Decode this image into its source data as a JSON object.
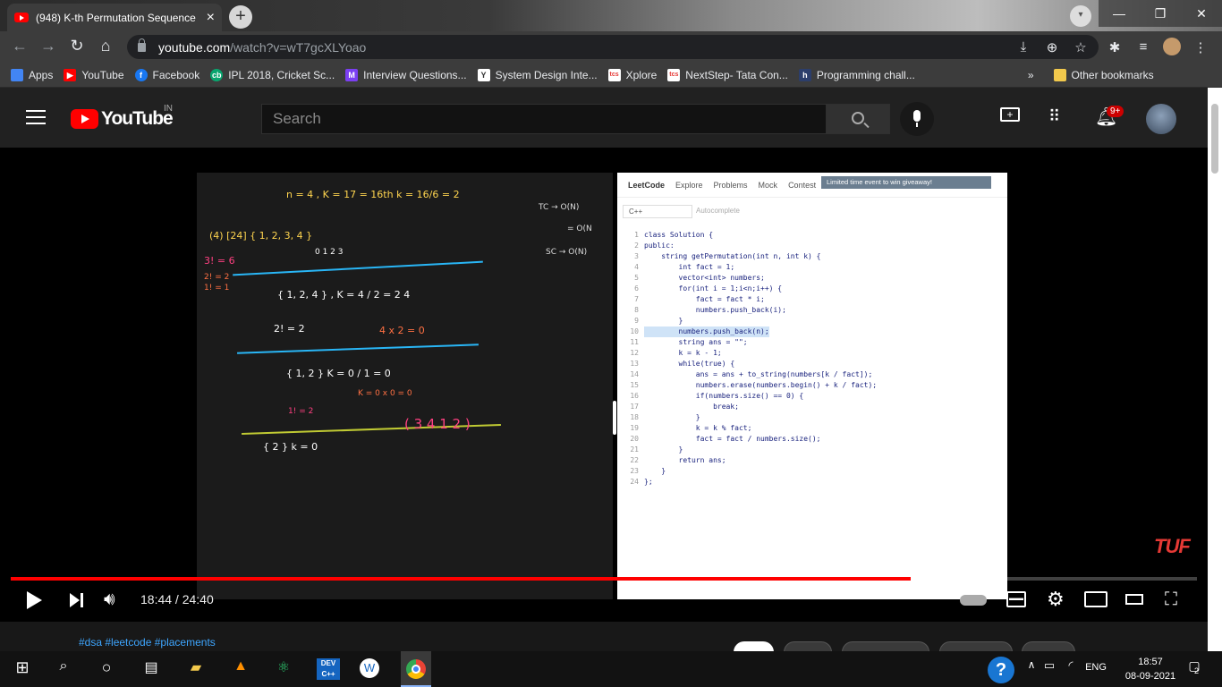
{
  "browser": {
    "tab_title": "(948) K-th Permutation Sequence",
    "url_host": "youtube.com",
    "url_path": "/watch?v=wT7gcXLYoao",
    "bookmarks": [
      {
        "label": "Apps",
        "icon": "apps-grid-icon",
        "color": "#4285f4"
      },
      {
        "label": "YouTube",
        "icon": "youtube-icon",
        "color": "#ff0000"
      },
      {
        "label": "Facebook",
        "icon": "facebook-icon",
        "color": "#1877f2"
      },
      {
        "label": "IPL 2018, Cricket Sc...",
        "icon": "cricbuzz-icon",
        "color": "#09a56e"
      },
      {
        "label": "Interview Questions...",
        "icon": "interview-icon",
        "color": "#7b3ff2"
      },
      {
        "label": "System Design Inte...",
        "icon": "system-design-icon",
        "color": "#ffffff"
      },
      {
        "label": "Xplore",
        "icon": "tcs-icon",
        "color": "#e53935"
      },
      {
        "label": "NextStep- Tata Con...",
        "icon": "tcs-icon",
        "color": "#e53935"
      },
      {
        "label": "Programming chall...",
        "icon": "hackerrank-icon",
        "color": "#2c3e6b"
      }
    ],
    "bookmarks_overflow": "»",
    "other_bookmarks": "Other bookmarks"
  },
  "youtube": {
    "logo_text": "YouTube",
    "region": "IN",
    "search_placeholder": "Search",
    "notif_count": "9+"
  },
  "video": {
    "current_time": "18:44",
    "duration": "24:40",
    "time_display": "18:44 / 24:40",
    "progress_played": 0.759,
    "progress_loaded": 0.83,
    "watermark": "TUF"
  },
  "leetcode": {
    "brand": "LeetCode",
    "nav": [
      "Explore",
      "Problems",
      "Mock",
      "Contest"
    ],
    "banner": "Limited time event to win giveaway!",
    "language": "C++",
    "autocomplete": "Autocomplete",
    "code": [
      {
        "n": "1",
        "t": "class Solution {"
      },
      {
        "n": "2",
        "t": "public:"
      },
      {
        "n": "3",
        "t": "    string getPermutation(int n, int k) {"
      },
      {
        "n": "4",
        "t": "        int fact = 1;"
      },
      {
        "n": "5",
        "t": "        vector<int> numbers;"
      },
      {
        "n": "6",
        "t": "        for(int i = 1;i<n;i++) {"
      },
      {
        "n": "7",
        "t": "            fact = fact * i;"
      },
      {
        "n": "8",
        "t": "            numbers.push_back(i);"
      },
      {
        "n": "9",
        "t": "        }"
      },
      {
        "n": "10",
        "t": "        numbers.push_back(n);"
      },
      {
        "n": "11",
        "t": "        string ans = \"\";"
      },
      {
        "n": "12",
        "t": "        k = k - 1;"
      },
      {
        "n": "13",
        "t": "        while(true) {"
      },
      {
        "n": "14",
        "t": "            ans = ans + to_string(numbers[k / fact]);"
      },
      {
        "n": "15",
        "t": "            numbers.erase(numbers.begin() + k / fact);"
      },
      {
        "n": "16",
        "t": "            if(numbers.size() == 0) {"
      },
      {
        "n": "17",
        "t": "                break;"
      },
      {
        "n": "18",
        "t": "            }"
      },
      {
        "n": "19",
        "t": "            k = k % fact;"
      },
      {
        "n": "20",
        "t": "            fact = fact / numbers.size();"
      },
      {
        "n": "21",
        "t": "        }"
      },
      {
        "n": "22",
        "t": "        return ans;"
      },
      {
        "n": "23",
        "t": "    }"
      },
      {
        "n": "24",
        "t": "};"
      }
    ]
  },
  "whiteboard": {
    "top_line": "n = 4 ,  K = 17   = 16th    k = 16/6 = 2",
    "complexity": [
      "TC → O(N)",
      "= O(N",
      "SC → O(N)"
    ],
    "row1": "(4) [24]        { 1, 2, 3, 4 }",
    "row1_idx": "0  1  2  3",
    "facts": [
      "3! = 6",
      "2! = 2",
      "1! = 1"
    ],
    "row2": "{ 1, 2, 4 }  ,  K = 4 / 2 = 2   4",
    "row2b": "2! = 2",
    "row2c": "4 x 2 = 0",
    "row3": "{ 1, 2 }     K = 0 / 1 = 0",
    "row3b": "K = 0 x 0 = 0",
    "row3c": "1! = 2",
    "row4": "{ 2 }     k = 0",
    "answer": "( 3  4  1  2 )"
  },
  "below": {
    "tags": "#dsa #leetcode #placements"
  },
  "taskbar": {
    "lang": "ENG",
    "time": "18:57",
    "date": "08-09-2021",
    "notif_count": "2"
  }
}
